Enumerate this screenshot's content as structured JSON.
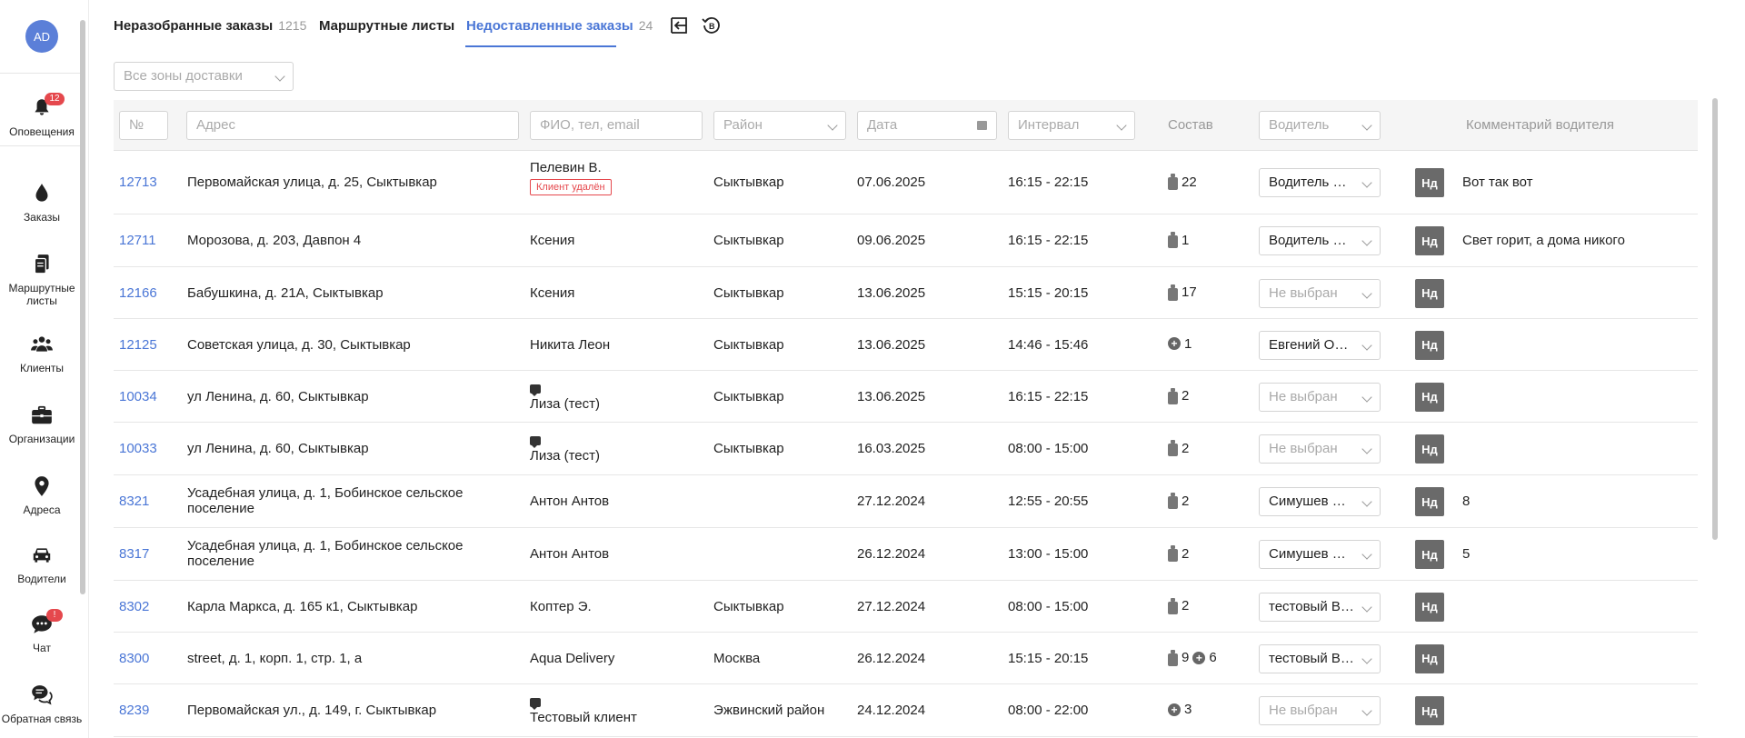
{
  "user": {
    "initials": "AD"
  },
  "sidebar": {
    "items": [
      {
        "label": "Оповещения",
        "icon": "bell-icon",
        "badge": "12"
      },
      {
        "label": "Заказы",
        "icon": "drop-icon"
      },
      {
        "label": "Маршрутные листы",
        "icon": "clipboard-icon"
      },
      {
        "label": "Клиенты",
        "icon": "people-icon"
      },
      {
        "label": "Организации",
        "icon": "briefcase-icon"
      },
      {
        "label": "Адреса",
        "icon": "pin-icon"
      },
      {
        "label": "Водители",
        "icon": "car-icon"
      },
      {
        "label": "Чат",
        "icon": "chat-icon",
        "badge": "!"
      },
      {
        "label": "Обратная связь",
        "icon": "feedback-icon"
      }
    ]
  },
  "tabs": [
    {
      "label": "Неразобранные заказы",
      "count": "1215"
    },
    {
      "label": "Маршрутные листы",
      "count": ""
    },
    {
      "label": "Недоставленные заказы",
      "count": "24"
    }
  ],
  "zone_filter": {
    "value": "Все зоны доставки"
  },
  "filters": {
    "num": "№",
    "address": "Адрес",
    "client": "ФИО, тел, email",
    "district": "Район",
    "date": "Дата",
    "interval": "Интервал",
    "composition": "Состав",
    "driver": "Водитель",
    "comment": "Комментарий водителя"
  },
  "rows": [
    {
      "id": "12713",
      "address": "Первомайская улица, д. 25, Сыктывкар",
      "client": "Пелевин В.",
      "client_badge": "Клиент удалён",
      "district": "Сыктывкар",
      "date": "07.06.2025",
      "interval": "16:15 - 22:15",
      "bottles": "22",
      "extras": "",
      "driver": "Водитель для тестов",
      "driver_empty": false,
      "nd": "Нд",
      "comment": "Вот так вот",
      "chat": false
    },
    {
      "id": "12711",
      "address": "Морозова, д. 203, Давпон 4",
      "client": "Ксения",
      "client_badge": "",
      "district": "Сыктывкар",
      "date": "09.06.2025",
      "interval": "16:15 - 22:15",
      "bottles": "1",
      "extras": "",
      "driver": "Водитель для тестов",
      "driver_empty": false,
      "nd": "Нд",
      "comment": "Свет горит, а дома никого",
      "chat": false
    },
    {
      "id": "12166",
      "address": "Бабушкина, д. 21А, Сыктывкар",
      "client": "Ксения",
      "client_badge": "",
      "district": "Сыктывкар",
      "date": "13.06.2025",
      "interval": "15:15 - 20:15",
      "bottles": "17",
      "extras": "",
      "driver": "Не выбран",
      "driver_empty": true,
      "nd": "Нд",
      "comment": "",
      "chat": false
    },
    {
      "id": "12125",
      "address": "Советская улица, д. 30, Сыктывкар",
      "client": "Никита Леон",
      "client_badge": "",
      "district": "Сыктывкар",
      "date": "13.06.2025",
      "interval": "14:46 - 15:46",
      "bottles": "",
      "extras": "1",
      "driver": "Евгений Овчинников",
      "driver_empty": false,
      "nd": "Нд",
      "comment": "",
      "chat": false
    },
    {
      "id": "10034",
      "address": "ул Ленина, д. 60, Сыктывкар",
      "client": "Лиза (тест)",
      "client_badge": "",
      "district": "Сыктывкар",
      "date": "13.06.2025",
      "interval": "16:15 - 22:15",
      "bottles": "2",
      "extras": "",
      "driver": "Не выбран",
      "driver_empty": true,
      "nd": "Нд",
      "comment": "",
      "chat": true
    },
    {
      "id": "10033",
      "address": "ул Ленина, д. 60, Сыктывкар",
      "client": "Лиза (тест)",
      "client_badge": "",
      "district": "Сыктывкар",
      "date": "16.03.2025",
      "interval": "08:00 - 15:00",
      "bottles": "2",
      "extras": "",
      "driver": "Не выбран",
      "driver_empty": true,
      "nd": "Нд",
      "comment": "",
      "chat": true
    },
    {
      "id": "8321",
      "address": "Усадебная улица, д. 1, Бобинское сельское поселение",
      "client": "Антон Антов",
      "client_badge": "",
      "district": "",
      "date": "27.12.2024",
      "interval": "12:55 - 20:55",
      "bottles": "2",
      "extras": "",
      "driver": "Симушев Алексей",
      "driver_empty": false,
      "nd": "Нд",
      "comment": "8",
      "chat": false
    },
    {
      "id": "8317",
      "address": "Усадебная улица, д. 1, Бобинское сельское поселение",
      "client": "Антон Антов",
      "client_badge": "",
      "district": "",
      "date": "26.12.2024",
      "interval": "13:00 - 15:00",
      "bottles": "2",
      "extras": "",
      "driver": "Симушев Алексей",
      "driver_empty": false,
      "nd": "Нд",
      "comment": "5",
      "chat": false
    },
    {
      "id": "8302",
      "address": "Карла Маркса, д. 165 к1, Сыктывкар",
      "client": "Коптер Э.",
      "client_badge": "",
      "district": "Сыктывкар",
      "date": "27.12.2024",
      "interval": "08:00 - 15:00",
      "bottles": "2",
      "extras": "",
      "driver": "тестовый Водитель",
      "driver_empty": false,
      "nd": "Нд",
      "comment": "",
      "chat": false
    },
    {
      "id": "8300",
      "address": "street, д. 1, корп. 1, стр. 1, а",
      "client": "Aqua Delivery",
      "client_badge": "",
      "district": "Москва",
      "date": "26.12.2024",
      "interval": "15:15 - 20:15",
      "bottles": "9",
      "extras": "6",
      "driver": "тестовый Водитель",
      "driver_empty": false,
      "nd": "Нд",
      "comment": "",
      "chat": false
    },
    {
      "id": "8239",
      "address": "Первомайская ул., д. 149, г. Сыктывкар",
      "client": "Тестовый клиент",
      "client_badge": "",
      "district": "Эжвинский район",
      "date": "24.12.2024",
      "interval": "08:00 - 22:00",
      "bottles": "",
      "extras": "3",
      "driver": "Не выбран",
      "driver_empty": true,
      "nd": "Нд",
      "comment": "",
      "chat": true
    }
  ]
}
